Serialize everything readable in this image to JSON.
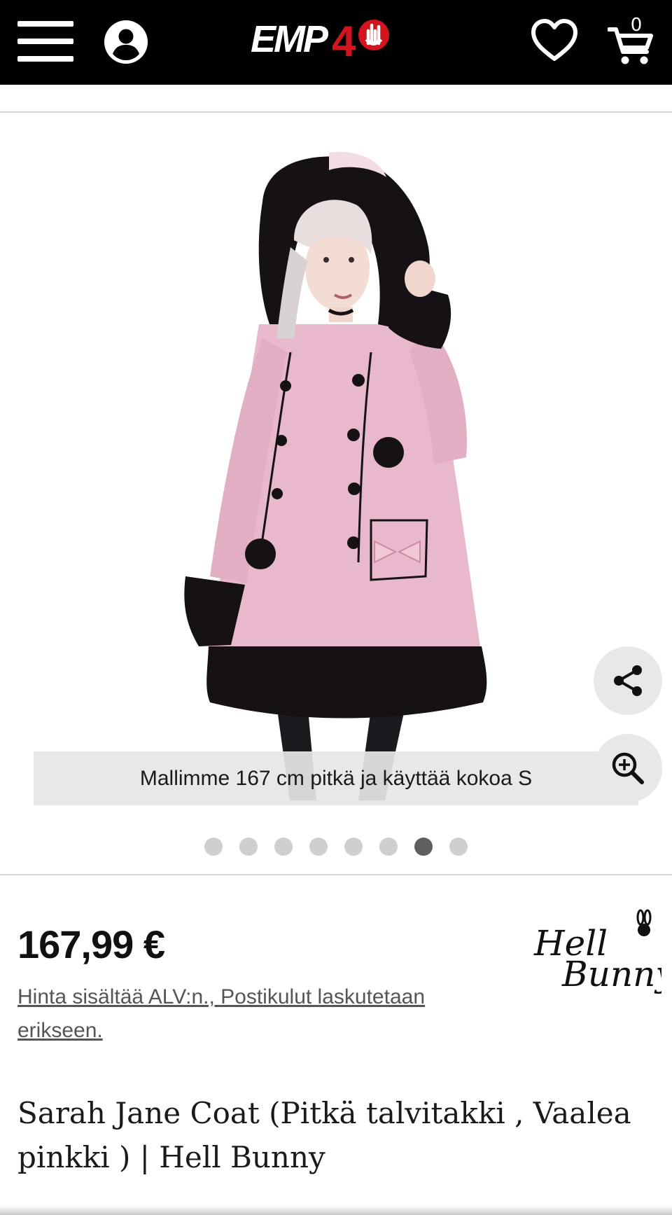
{
  "header": {
    "menu_icon": "hamburger-menu-icon",
    "account_icon": "user-account-icon",
    "logo_text": "EMP40",
    "wishlist_icon": "heart-icon",
    "cart_icon": "shopping-cart-icon",
    "cart_count": "0"
  },
  "gallery": {
    "image_alt": "Hell Bunny Sarah Jane Coat pink winter coat",
    "caption": "Mallimme 167 cm pitkä ja käyttää kokoa S",
    "share_icon": "share-icon",
    "zoom_icon": "zoom-in-icon",
    "slide_count": 8,
    "active_slide": 7
  },
  "product": {
    "price": "167,99 €",
    "vat_note": "Hinta sisältää ALV:n., Postikulut laskutetaan erikseen.",
    "brand_logo_text": "Hell Bunny",
    "title": "Sarah Jane Coat (Pitkä talvitakki , Vaalea pinkki ) | Hell Bunny"
  },
  "colors": {
    "header_bg": "#000000",
    "logo_accent": "#d2141e",
    "coat_pink": "#e8b9cc",
    "fur_black": "#151115",
    "dot_active": "#5f5f5f",
    "dot_inactive": "#cfcfcf"
  }
}
